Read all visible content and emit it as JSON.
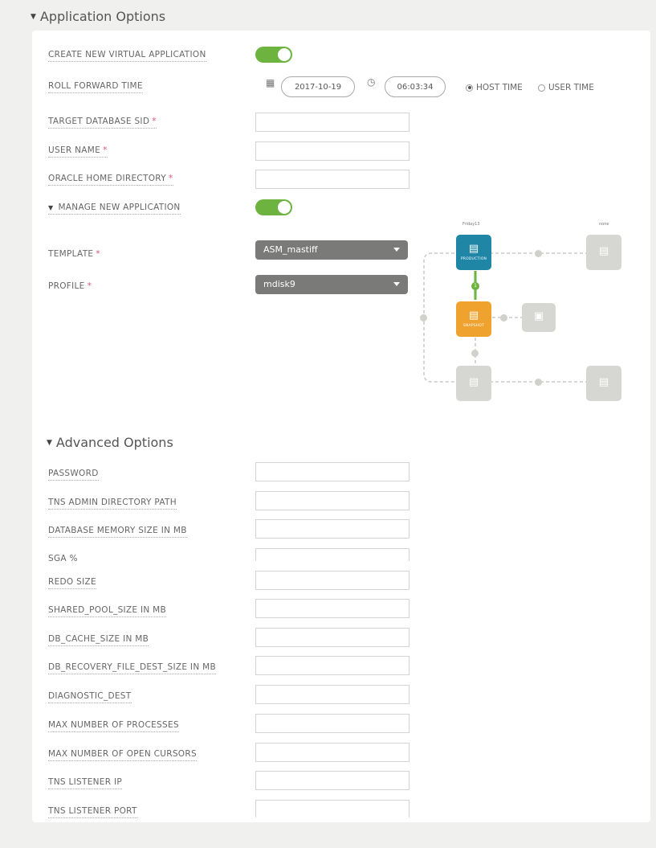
{
  "app_options": {
    "title": "Application Options",
    "create_label": "CREATE NEW VIRTUAL APPLICATION",
    "roll_label": "ROLL FORWARD TIME",
    "date_value": "2017-10-19",
    "time_value": "06:03:34",
    "host_time": "HOST TIME",
    "user_time": "USER TIME",
    "sid_label": "TARGET DATABASE SID",
    "username_label": "USER NAME",
    "oracle_home_label": "ORACLE HOME DIRECTORY",
    "manage_label": "MANAGE NEW APPLICATION",
    "template_label": "TEMPLATE",
    "template_value": "ASM_mastiff",
    "profile_label": "PROFILE",
    "profile_value": "mdisk9",
    "required_mark": "*"
  },
  "diagram": {
    "top_left_caption": "Friday13",
    "top_right_caption": "none",
    "nodes": [
      {
        "label": "PRODUCTION",
        "color": "#1f86a6"
      },
      {
        "label": "SNAPSHOT",
        "color": "#f0a22e"
      },
      {
        "label": "",
        "color": "#d6d6d2"
      },
      {
        "label": "",
        "color": "#d6d6d2"
      },
      {
        "label": "",
        "color": "#d6d6d2"
      },
      {
        "label": "",
        "color": "#d6d6d2"
      }
    ],
    "green_dot_label": "1"
  },
  "advanced": {
    "title": "Advanced Options",
    "fields": [
      "PASSWORD",
      "TNS ADMIN DIRECTORY PATH",
      "DATABASE MEMORY SIZE IN MB",
      "SGA %",
      "REDO SIZE",
      "SHARED_POOL_SIZE IN MB",
      "DB_CACHE_SIZE IN MB",
      "DB_RECOVERY_FILE_DEST_SIZE IN MB",
      "DIAGNOSTIC_DEST",
      "MAX NUMBER OF PROCESSES",
      "MAX NUMBER OF OPEN CURSORS",
      "TNS LISTENER IP",
      "TNS LISTENER PORT"
    ]
  }
}
